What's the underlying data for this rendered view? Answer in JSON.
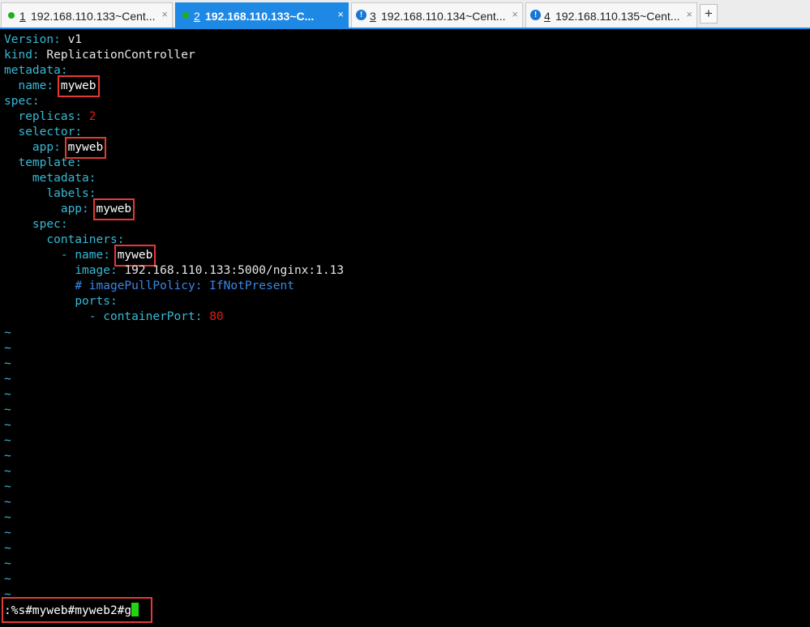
{
  "tabs": [
    {
      "num": "1",
      "title": "192.168.110.133~Cent...",
      "status": "connected"
    },
    {
      "num": "2",
      "title": "192.168.110.133~C...",
      "status": "connected",
      "active": true
    },
    {
      "num": "3",
      "title": "192.168.110.134~Cent...",
      "status": "alert"
    },
    {
      "num": "4",
      "title": "192.168.110.135~Cent...",
      "status": "alert"
    }
  ],
  "tab_close": "×",
  "tab_alert": "!",
  "new_tab": "+",
  "yaml": {
    "l1": {
      "key": "Version",
      "value": "v1"
    },
    "l2": {
      "key": "kind",
      "value": "ReplicationController"
    },
    "l3": {
      "key": "metadata"
    },
    "l4": {
      "key": "name",
      "value": "myweb"
    },
    "l5": {
      "key": "spec"
    },
    "l6": {
      "key": "replicas",
      "value": "2"
    },
    "l7": {
      "key": "selector"
    },
    "l8": {
      "key": "app",
      "value": "myweb"
    },
    "l9": {
      "key": "template"
    },
    "l10": {
      "key": "metadata"
    },
    "l11": {
      "key": "labels"
    },
    "l12": {
      "key": "app",
      "value": "myweb"
    },
    "l13": {
      "key": "spec"
    },
    "l14": {
      "key": "containers"
    },
    "l15": {
      "key": "name",
      "value": "myweb"
    },
    "l16": {
      "key": "image",
      "value": "192.168.110.133:5000/nginx:1.13"
    },
    "l17": {
      "comment": "# imagePullPolicy: IfNotPresent"
    },
    "l18": {
      "key": "ports"
    },
    "l19": {
      "key": "containerPort",
      "value": "80"
    }
  },
  "tilde": "~",
  "command": ":%s#myweb#myweb2#g",
  "colors": {
    "accent": "#1e88e5",
    "key": "#37b9d6",
    "number": "#e01b1b",
    "comment": "#3a87e8",
    "highlight_box": "#e53935",
    "cursor": "#22d60e"
  }
}
